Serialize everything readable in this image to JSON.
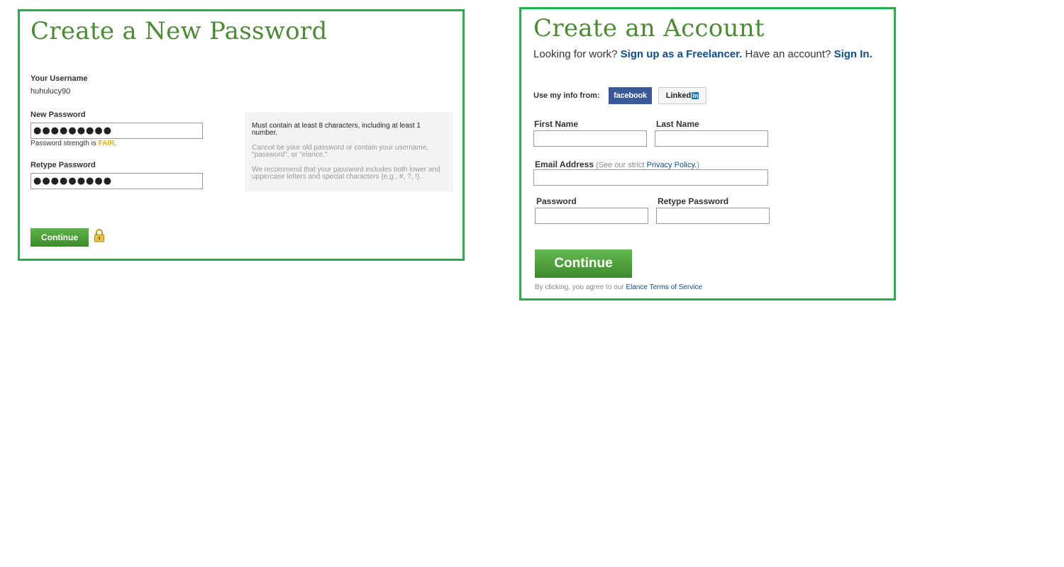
{
  "reset": {
    "title": "Create a New Password",
    "username_label": "Your Username",
    "username_value": "huhulucy90",
    "new_password_label": "New Password",
    "new_password_value": "●●●●●●●●●",
    "strength_prefix": "Password strength is ",
    "strength_value": "FAIR",
    "strength_suffix": ".",
    "retype_label": "Retype Password",
    "retype_value": "●●●●●●●●●",
    "hints": [
      "Must contain at least 8 characters, including at least 1 number.",
      "Cannot be your old password or contain your username, \"password\", or \"elance.\"",
      "We recommend that your password includes both lower and uppercase letters and special characters (e.g., #, ?, !)."
    ],
    "continue_label": "Continue",
    "lock_icon": "lock-icon"
  },
  "signup": {
    "title": "Create an Account",
    "looking_text": "Looking for work? ",
    "freelancer_link": "Sign up as a Freelancer.",
    "have_account_text": " Have an account? ",
    "signin_link": "Sign In.",
    "use_info_label": "Use my info from:",
    "facebook_label": "facebook",
    "linkedin_label": "Linked",
    "linkedin_in": "in",
    "first_name_label": "First Name",
    "last_name_label": "Last Name",
    "email_label": "Email Address",
    "email_note_prefix": " (See our strict ",
    "privacy_link": "Privacy Policy.",
    "email_note_suffix": ")",
    "password_label": "Password",
    "retype_label": "Retype Password",
    "continue_label": "Continue",
    "terms_prefix": "By clicking, you agree to our ",
    "terms_link": "Elance Terms of Service"
  },
  "colors": {
    "border": "#2eaa4e",
    "title": "#4d8a35",
    "link": "#0e4f8a",
    "fair": "#e0b010",
    "facebook": "#3b5998"
  }
}
